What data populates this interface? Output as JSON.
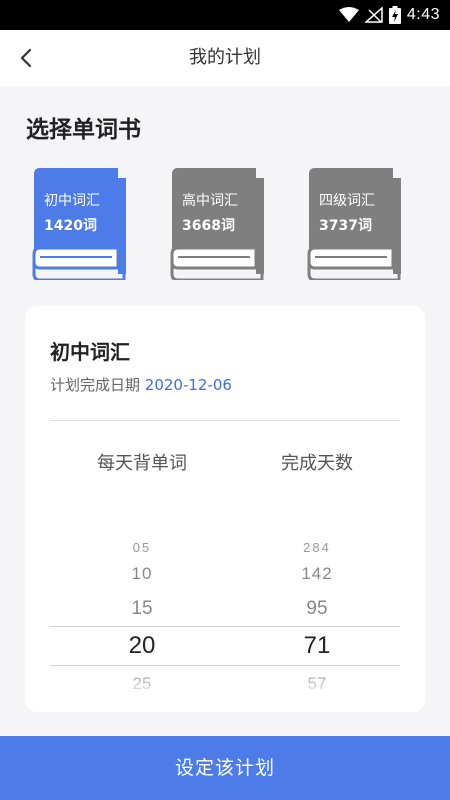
{
  "status_bar": {
    "time": "4:43",
    "icons": [
      "wifi-icon",
      "signal-icon",
      "battery-charging-icon"
    ]
  },
  "header": {
    "title": "我的计划",
    "back_icon": "chevron-left-icon"
  },
  "section_title": "选择单词书",
  "books": [
    {
      "name": "初中词汇",
      "count": "1420词",
      "selected": true,
      "color": "#4d7ce8"
    },
    {
      "name": "高中词汇",
      "count": "3668词",
      "selected": false,
      "color": "#7f7f7f"
    },
    {
      "name": "四级词汇",
      "count": "3737词",
      "selected": false,
      "color": "#7f7f7f"
    }
  ],
  "plan": {
    "book_name": "初中词汇",
    "date_label": "计划完成日期",
    "date_value": "2020-12-06",
    "per_day_header": "每天背单词",
    "days_header": "完成天数",
    "per_day_options": [
      "05",
      "10",
      "15",
      "20",
      "25"
    ],
    "days_options": [
      "284",
      "142",
      "95",
      "71",
      "57"
    ],
    "selected_per_day": "20",
    "selected_days": "71"
  },
  "bottom_button": "设定该计划",
  "colors": {
    "accent": "#4d7ce8",
    "date": "#3f6ed3",
    "book_inactive": "#7f7f7f"
  }
}
